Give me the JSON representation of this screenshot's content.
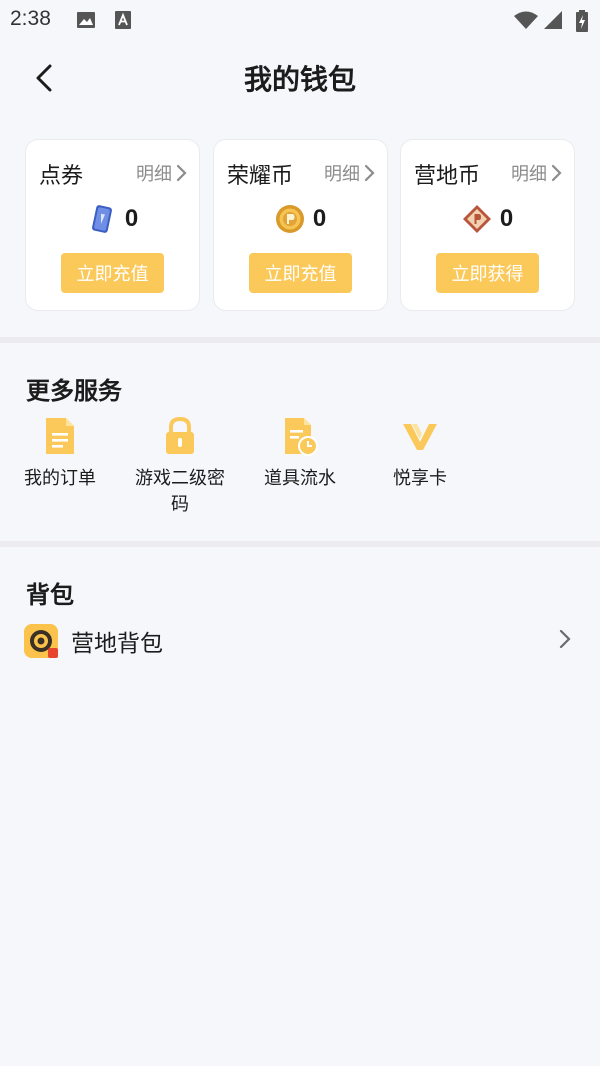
{
  "status_bar": {
    "time": "2:38",
    "icons": [
      "image-notification-icon",
      "text-notification-icon",
      "wifi-icon",
      "signal-icon",
      "battery-icon"
    ]
  },
  "header": {
    "title": "我的钱包",
    "back_icon": "chevron-left-icon"
  },
  "wallet": {
    "cards": [
      {
        "title": "点券",
        "detail_label": "明细",
        "amount": "0",
        "icon": "coupon-card-icon",
        "action_label": "立即充值"
      },
      {
        "title": "荣耀币",
        "detail_label": "明细",
        "amount": "0",
        "icon": "honor-coin-icon",
        "action_label": "立即充值"
      },
      {
        "title": "营地币",
        "detail_label": "明细",
        "amount": "0",
        "icon": "camp-coin-icon",
        "action_label": "立即获得"
      }
    ]
  },
  "services": {
    "title": "更多服务",
    "items": [
      {
        "label": "我的订单",
        "icon": "document-icon"
      },
      {
        "label": "游戏二级密码",
        "icon": "lock-icon"
      },
      {
        "label": "道具流水",
        "icon": "document-clock-icon"
      },
      {
        "label": "悦享卡",
        "icon": "v-logo-icon"
      }
    ]
  },
  "backpack": {
    "title": "背包",
    "item_label": "营地背包",
    "item_icon": "camp-backpack-app-icon"
  },
  "colors": {
    "accent": "#fbc95a",
    "background": "#f6f7fb",
    "card": "#ffffff",
    "muted_text": "#8c8c8c"
  }
}
